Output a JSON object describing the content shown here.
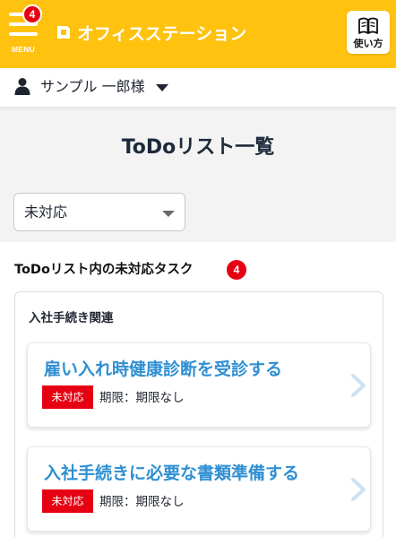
{
  "header": {
    "menu_label": "MENU",
    "notification_count": "4",
    "logo_text": "オフィスステーション",
    "guide_label": "使い方"
  },
  "user": {
    "name": "サンプル 一郎様"
  },
  "page": {
    "title": "ToDoリスト一覧"
  },
  "filter": {
    "selected": "未対応"
  },
  "section": {
    "heading": "ToDoリスト内の未対応タスク",
    "count": "4",
    "group_title": "入社手続き関連",
    "tasks": [
      {
        "title": "雇い入れ時健康診断を受診する",
        "status": "未対応",
        "due": "期限：期限なし"
      },
      {
        "title": "入社手続きに必要な書類準備する",
        "status": "未対応",
        "due": "期限：期限なし"
      }
    ]
  },
  "colors": {
    "brand": "#ffc20f",
    "link": "#2f8fd2",
    "alert": "#e60012"
  }
}
